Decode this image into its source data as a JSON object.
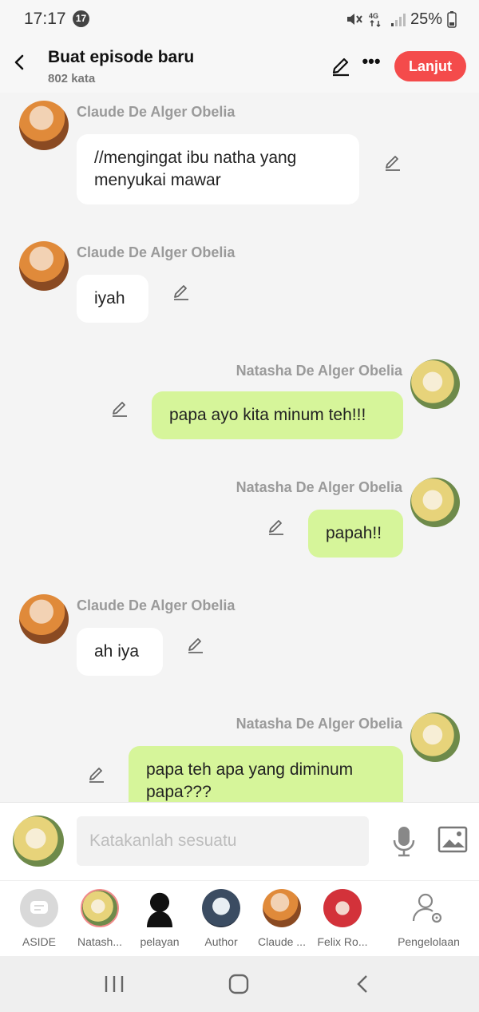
{
  "status_bar": {
    "time": "17:17",
    "notification_count": "17",
    "battery": "25%"
  },
  "header": {
    "title": "Buat episode baru",
    "word_count": "802 kata",
    "next_label": "Lanjut"
  },
  "messages": [
    {
      "side": "left",
      "sender": "Claude De Alger Obelia",
      "text": "//mengingat ibu natha yang menyukai mawar"
    },
    {
      "side": "left",
      "sender": "Claude De Alger Obelia",
      "text": "iyah"
    },
    {
      "side": "right",
      "sender": "Natasha De Alger Obelia",
      "text": "papa ayo kita minum teh!!!"
    },
    {
      "side": "right",
      "sender": "Natasha De Alger Obelia",
      "text": "papah!!"
    },
    {
      "side": "left",
      "sender": "Claude De Alger Obelia",
      "text": "ah iya"
    },
    {
      "side": "right",
      "sender": "Natasha De Alger Obelia",
      "text": "papa teh apa yang diminum papa???"
    }
  ],
  "input": {
    "placeholder": "Katakanlah sesuatu"
  },
  "characters": [
    {
      "label": "ASIDE"
    },
    {
      "label": "Natash..."
    },
    {
      "label": "pelayan"
    },
    {
      "label": "Author"
    },
    {
      "label": "Claude ..."
    },
    {
      "label": "Felix Ro..."
    },
    {
      "label": "Pengelolaan"
    }
  ]
}
